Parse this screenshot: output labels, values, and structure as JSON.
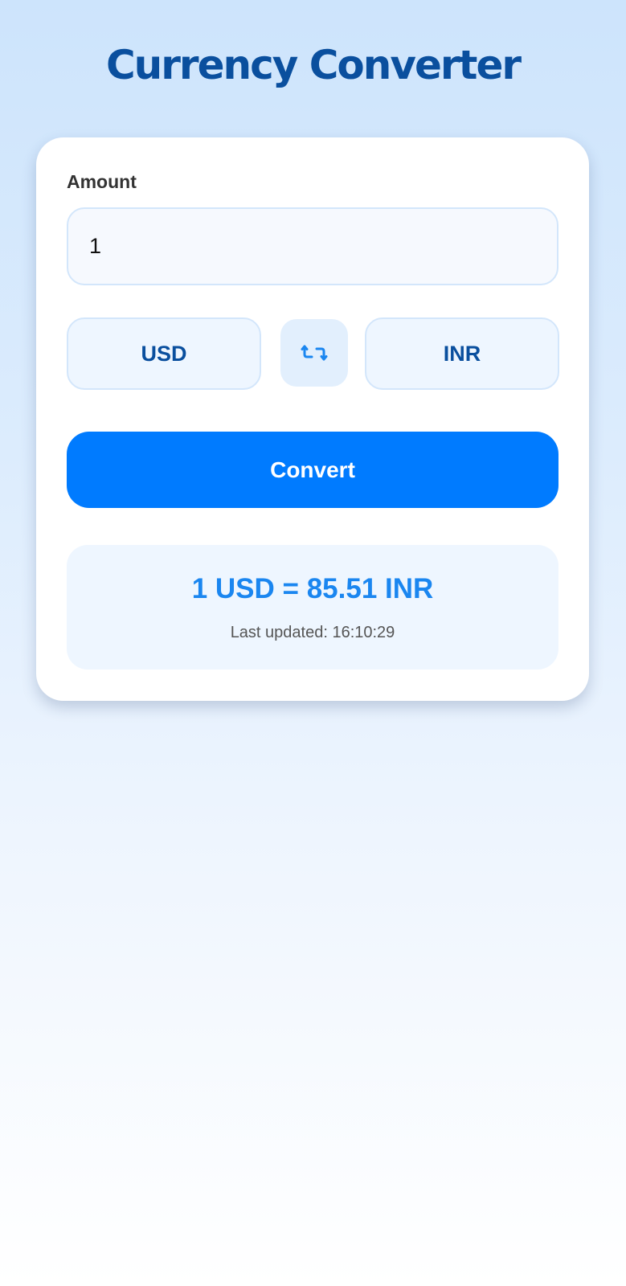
{
  "app": {
    "title": "Currency Converter"
  },
  "form": {
    "amount_label": "Amount",
    "amount_value": "1",
    "from_currency": "USD",
    "to_currency": "INR",
    "swap_icon": "swap-icon",
    "convert_label": "Convert"
  },
  "result": {
    "conversion_text": "1 USD = 85.51 INR",
    "last_updated_text": "Last updated: 16:10:29"
  },
  "colors": {
    "primary": "#007bff",
    "title": "#0a4f9e",
    "result": "#1a86f0"
  }
}
